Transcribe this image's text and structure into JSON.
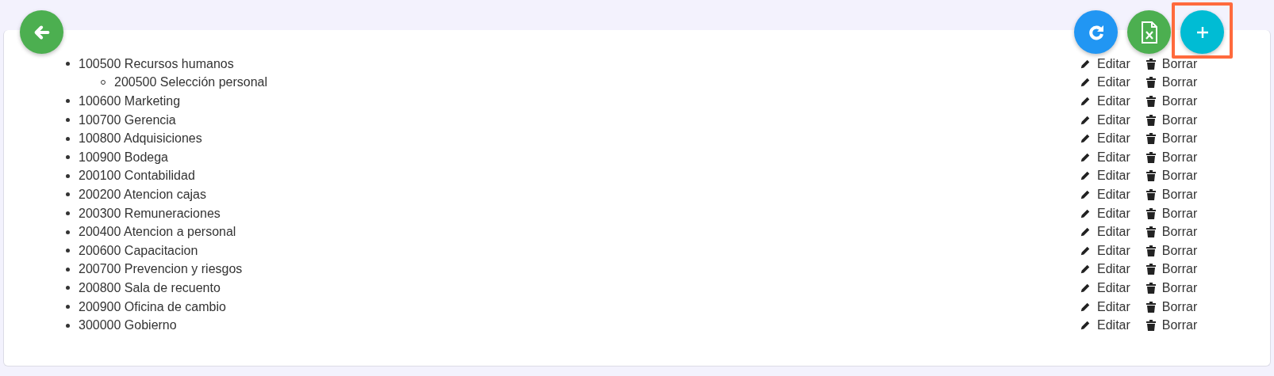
{
  "toolbar": {
    "back_button": {
      "kind": "back"
    },
    "actions": [
      {
        "kind": "refresh",
        "highlighted": false
      },
      {
        "kind": "excel",
        "highlighted": false
      },
      {
        "kind": "add",
        "highlighted": true
      }
    ]
  },
  "departments": [
    {
      "label": "100500 Recursos humanos",
      "edit": "Editar",
      "delete": "Borrar",
      "children": [
        {
          "label": "200500 Selección personal",
          "edit": "Editar",
          "delete": "Borrar"
        }
      ]
    },
    {
      "label": "100600 Marketing",
      "edit": "Editar",
      "delete": "Borrar"
    },
    {
      "label": "100700 Gerencia",
      "edit": "Editar",
      "delete": "Borrar"
    },
    {
      "label": "100800 Adquisiciones",
      "edit": "Editar",
      "delete": "Borrar"
    },
    {
      "label": "100900 Bodega",
      "edit": "Editar",
      "delete": "Borrar"
    },
    {
      "label": "200100 Contabilidad",
      "edit": "Editar",
      "delete": "Borrar"
    },
    {
      "label": "200200 Atencion cajas",
      "edit": "Editar",
      "delete": "Borrar"
    },
    {
      "label": "200300 Remuneraciones",
      "edit": "Editar",
      "delete": "Borrar"
    },
    {
      "label": "200400 Atencion a personal",
      "edit": "Editar",
      "delete": "Borrar"
    },
    {
      "label": "200600 Capacitacion",
      "edit": "Editar",
      "delete": "Borrar"
    },
    {
      "label": "200700 Prevencion y riesgos",
      "edit": "Editar",
      "delete": "Borrar"
    },
    {
      "label": "200800 Sala de recuento",
      "edit": "Editar",
      "delete": "Borrar"
    },
    {
      "label": "200900 Oficina de cambio",
      "edit": "Editar",
      "delete": "Borrar"
    },
    {
      "label": "300000 Gobierno",
      "edit": "Editar",
      "delete": "Borrar"
    }
  ]
}
